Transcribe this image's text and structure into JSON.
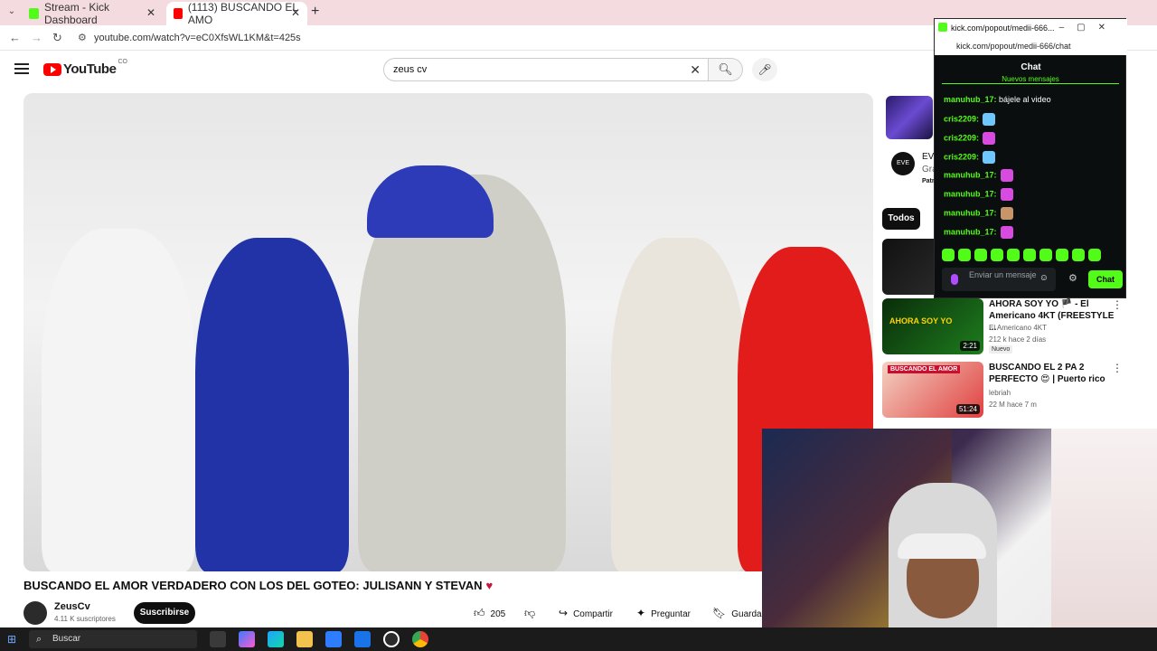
{
  "browser": {
    "tabs": [
      {
        "label": "Stream - Kick Dashboard",
        "icon": "kick-favicon",
        "color": "#53fc18"
      },
      {
        "label": "(1113) BUSCANDO EL AMO",
        "icon": "youtube-favicon",
        "color": "#ff0000"
      }
    ],
    "url": "youtube.com/watch?v=eC0XfsWL1KM&t=425s"
  },
  "youtube": {
    "logo": "YouTube",
    "region": "CO",
    "search_value": "zeus cv",
    "video": {
      "title": "BUSCANDO EL AMOR VERDADERO CON LOS DEL GOTEO: JULISANN Y STEVAN",
      "channel": "ZeusCv",
      "subscribers": "4.11 K suscriptores",
      "subscribe_label": "Suscribirse",
      "likes": "205",
      "share_label": "Compartir",
      "ask_label": "Preguntar",
      "save_label": "Guardar"
    },
    "ad": {
      "logo_text": "EVE",
      "line1": "EV",
      "line2": "Gra",
      "line3": "Patr"
    },
    "chip_all": "Todos",
    "recommendations": [
      {
        "title": "AHORA SOY YO 🏴 - El Americano 4KT (FREESTYLE ...",
        "channel": "El Americano 4KT",
        "meta": "212 k  hace 2 días",
        "badge": "Nuevo",
        "duration": "2:21",
        "thumb_text": "AHORA SOY YO"
      },
      {
        "title": "BUSCANDO EL 2 PA 2 PERFECTO 😍 | Puerto rico",
        "channel": "lebriah",
        "meta": "22 M  hace 7 m",
        "duration": "51:24",
        "thumb_text": "BUSCANDO EL AMOR"
      }
    ]
  },
  "kick_popout": {
    "window_title": "kick.com/popout/medii-666...",
    "url": "kick.com/popout/medii-666/chat",
    "chat_header": "Chat",
    "new_messages": "Nuevos mensajes",
    "messages": [
      {
        "user": "manuhub_17:",
        "text": "bájele al video",
        "emote": ""
      },
      {
        "user": "cris2209:",
        "text": "",
        "emote": "blue"
      },
      {
        "user": "cris2209:",
        "text": "",
        "emote": "pink"
      },
      {
        "user": "cris2209:",
        "text": "",
        "emote": "blue"
      },
      {
        "user": "manuhub_17:",
        "text": "",
        "emote": "pink"
      },
      {
        "user": "manuhub_17:",
        "text": "",
        "emote": "pink"
      },
      {
        "user": "manuhub_17:",
        "text": "",
        "emote": "face"
      },
      {
        "user": "manuhub_17:",
        "text": "",
        "emote": "pink"
      }
    ],
    "input_placeholder": "Enviar un mensaje",
    "send_label": "Chat"
  },
  "taskbar": {
    "search_placeholder": "Buscar"
  }
}
